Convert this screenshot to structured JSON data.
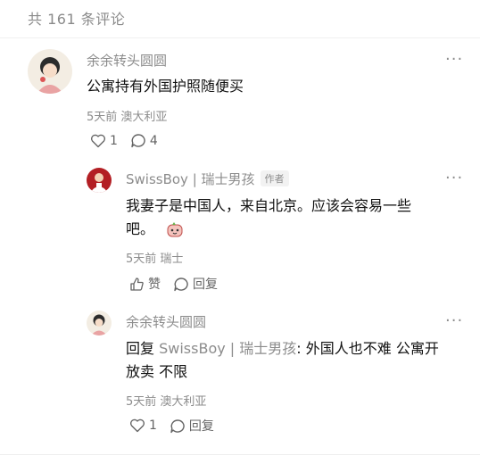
{
  "header": {
    "count_text": "共 161 条评论"
  },
  "comments": [
    {
      "user": "余余转头圆圆",
      "text": "公寓持有外国护照随便买",
      "time": "5天前",
      "location": "澳大利亚",
      "likes": "1",
      "replies": "4"
    },
    {
      "user": "SwissBoy | 瑞士男孩",
      "badge": "作者",
      "text_line1": "我妻子是中国人，来自北京。应该会容易一些",
      "text_line2": "吧。",
      "time": "5天前",
      "location": "瑞士",
      "like_label": "赞",
      "reply_label": "回复"
    },
    {
      "user": "余余转头圆圆",
      "reply_prefix": "回复",
      "reply_to": "SwissBoy | 瑞士男孩",
      "text_line1": ": 外国人也不难 公寓开",
      "text_line2": "放卖 不限",
      "time": "5天前",
      "location": "澳大利亚",
      "likes": "1",
      "reply_label": "回复"
    }
  ],
  "icons": {
    "more": "more-dots-icon",
    "like": "heart-icon",
    "comment": "comment-bubble-icon",
    "emoji": "emoji-sticker-icon"
  }
}
